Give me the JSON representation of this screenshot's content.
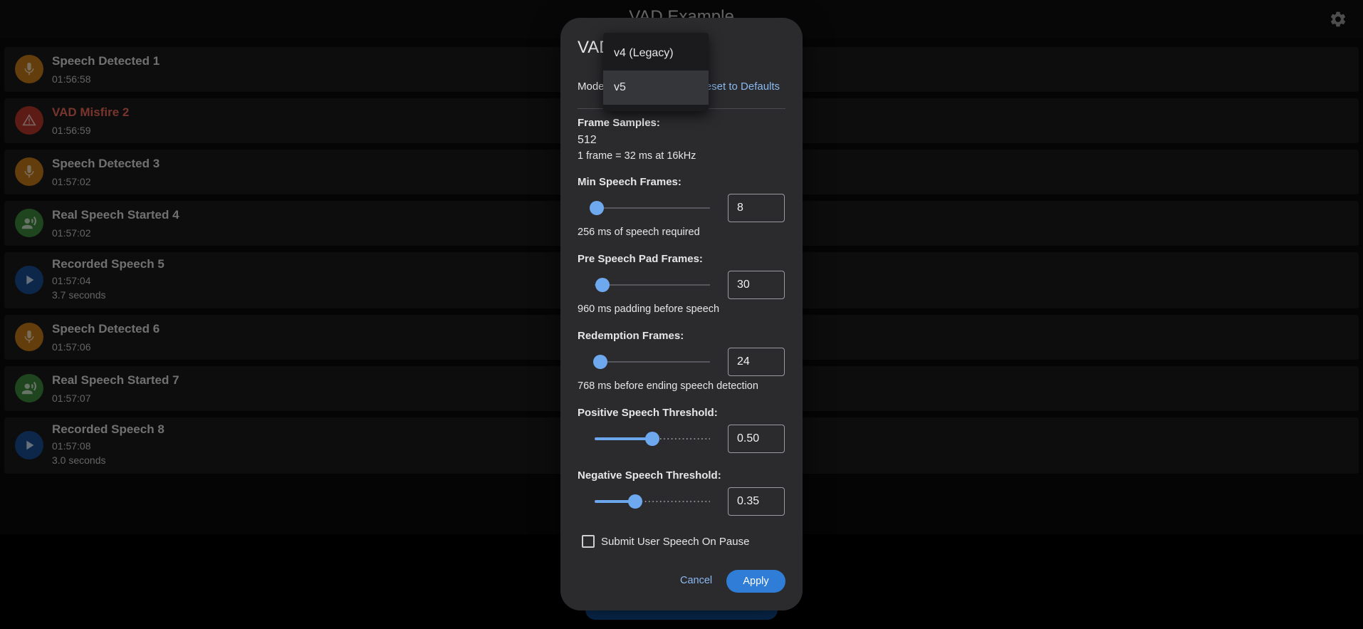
{
  "app": {
    "title": "VAD Example",
    "settings_icon": "gear-icon"
  },
  "events": [
    {
      "title": "Speech Detected 1",
      "time": "01:56:58",
      "kind": "speech-detected",
      "icon": "microphone-icon",
      "color": "#c77a17"
    },
    {
      "title": "VAD Misfire 2",
      "time": "01:56:59",
      "kind": "misfire",
      "icon": "warning-icon",
      "color": "#b8362a"
    },
    {
      "title": "Speech Detected 3",
      "time": "01:57:02",
      "kind": "speech-detected",
      "icon": "microphone-icon",
      "color": "#c77a17"
    },
    {
      "title": "Real Speech Started 4",
      "time": "01:57:02",
      "kind": "real-speech",
      "icon": "voice-icon",
      "color": "#3d8a3d"
    },
    {
      "title": "Recorded Speech 5",
      "time": "01:57:04",
      "duration": "3.7 seconds",
      "kind": "recorded",
      "icon": "play-icon",
      "color": "#1a4f95"
    },
    {
      "title": "Speech Detected 6",
      "time": "01:57:06",
      "kind": "speech-detected",
      "icon": "microphone-icon",
      "color": "#c77a17"
    },
    {
      "title": "Real Speech Started 7",
      "time": "01:57:07",
      "kind": "real-speech",
      "icon": "voice-icon",
      "color": "#3d8a3d"
    },
    {
      "title": "Recorded Speech 8",
      "time": "01:57:08",
      "duration": "3.0 seconds",
      "kind": "recorded",
      "icon": "play-icon",
      "color": "#1a4f95"
    }
  ],
  "dialog": {
    "title": "VAD Settings",
    "model_label": "Model",
    "reset_label": "Reset to Defaults",
    "frame_samples": {
      "label": "Frame Samples:",
      "value": "512",
      "help": "1 frame = 32 ms at 16kHz"
    },
    "min_speech_frames": {
      "label": "Min Speech Frames:",
      "value": "8",
      "slider_fraction": 0.02,
      "help": "256 ms of speech required"
    },
    "pre_speech_pad_frames": {
      "label": "Pre Speech Pad Frames:",
      "value": "30",
      "slider_fraction": 0.07,
      "help": "960 ms padding before speech"
    },
    "redemption_frames": {
      "label": "Redemption Frames:",
      "value": "24",
      "slider_fraction": 0.05,
      "help": "768 ms before ending speech detection"
    },
    "positive_threshold": {
      "label": "Positive Speech Threshold:",
      "value": "0.50",
      "slider_fraction": 0.5
    },
    "negative_threshold": {
      "label": "Negative Speech Threshold:",
      "value": "0.35",
      "slider_fraction": 0.35
    },
    "submit_on_pause": {
      "label": "Submit User Speech On Pause",
      "checked": false
    },
    "cancel_label": "Cancel",
    "apply_label": "Apply"
  },
  "model_menu": {
    "options": [
      "v4 (Legacy)",
      "v5"
    ],
    "selected": "v5"
  },
  "colors": {
    "accent": "#6ea9ef",
    "apply_button": "#2f7dd6",
    "dialog_bg": "#2b2b2e",
    "misfire_text": "#ef6a5a"
  }
}
